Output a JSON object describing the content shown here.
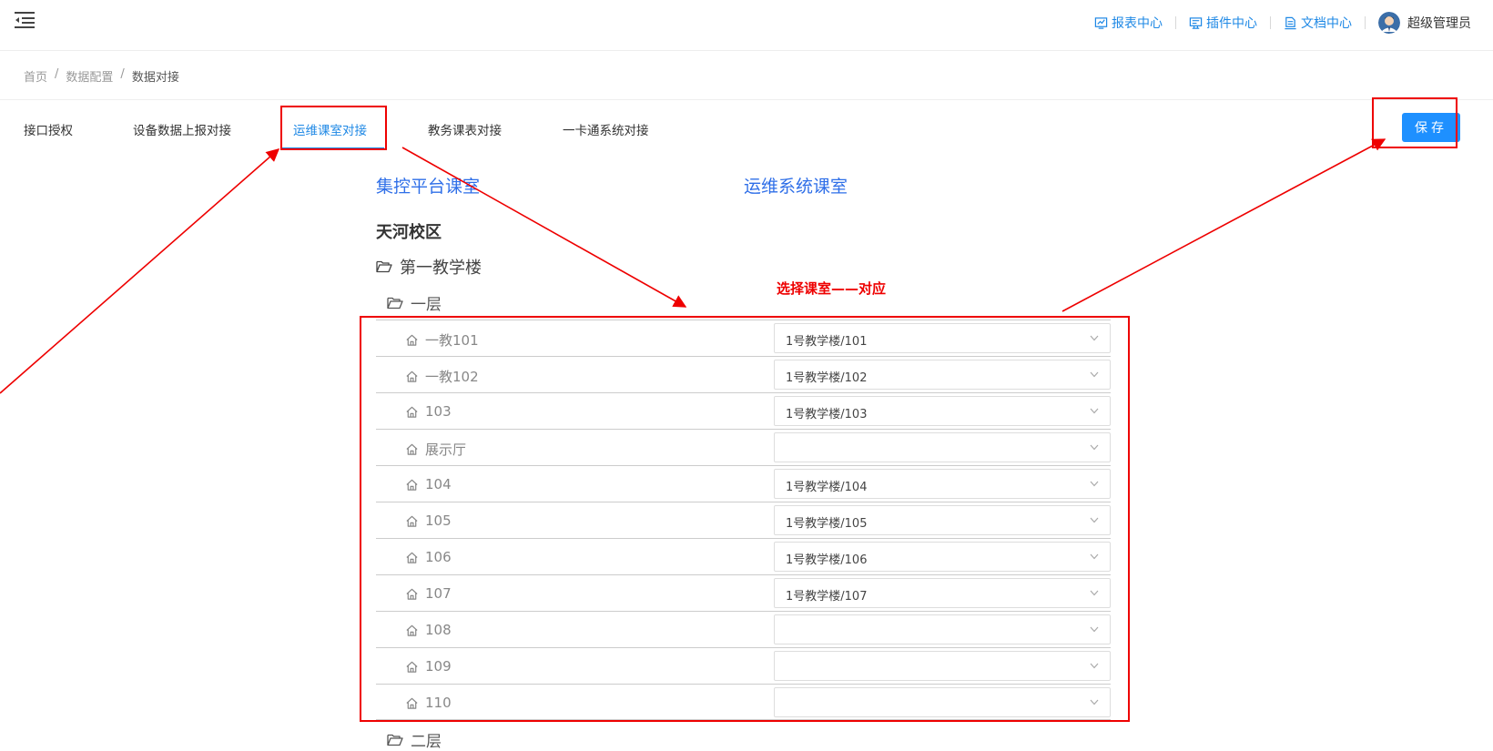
{
  "header": {
    "links": [
      {
        "label": "报表中心",
        "icon": "chart-icon"
      },
      {
        "label": "插件中心",
        "icon": "plugin-icon"
      },
      {
        "label": "文档中心",
        "icon": "document-icon"
      }
    ],
    "user_name": "超级管理员"
  },
  "breadcrumb": [
    "首页",
    "数据配置",
    "数据对接"
  ],
  "tabs": [
    "接口授权",
    "设备数据上报对接",
    "运维课室对接",
    "教务课表对接",
    "一卡通系统对接"
  ],
  "active_tab": "运维课室对接",
  "save_label": "保存",
  "columns": {
    "left": "集控平台课室",
    "right": "运维系统课室"
  },
  "campus": "天河校区",
  "building": "第一教学楼",
  "floors": [
    "一层",
    "二层"
  ],
  "rooms": [
    {
      "name": "一教101",
      "mapped": "1号教学楼/101"
    },
    {
      "name": "一教102",
      "mapped": "1号教学楼/102"
    },
    {
      "name": "103",
      "mapped": "1号教学楼/103"
    },
    {
      "name": "展示厅",
      "mapped": ""
    },
    {
      "name": "104",
      "mapped": "1号教学楼/104"
    },
    {
      "name": "105",
      "mapped": "1号教学楼/105"
    },
    {
      "name": "106",
      "mapped": "1号教学楼/106"
    },
    {
      "name": "107",
      "mapped": "1号教学楼/107"
    },
    {
      "name": "108",
      "mapped": ""
    },
    {
      "name": "109",
      "mapped": ""
    },
    {
      "name": "110",
      "mapped": ""
    }
  ],
  "annotation": "选择课室——对应",
  "colors": {
    "accent": "#1e88e5",
    "annotation": "#e00000",
    "title_blue": "#2f6fe8"
  }
}
